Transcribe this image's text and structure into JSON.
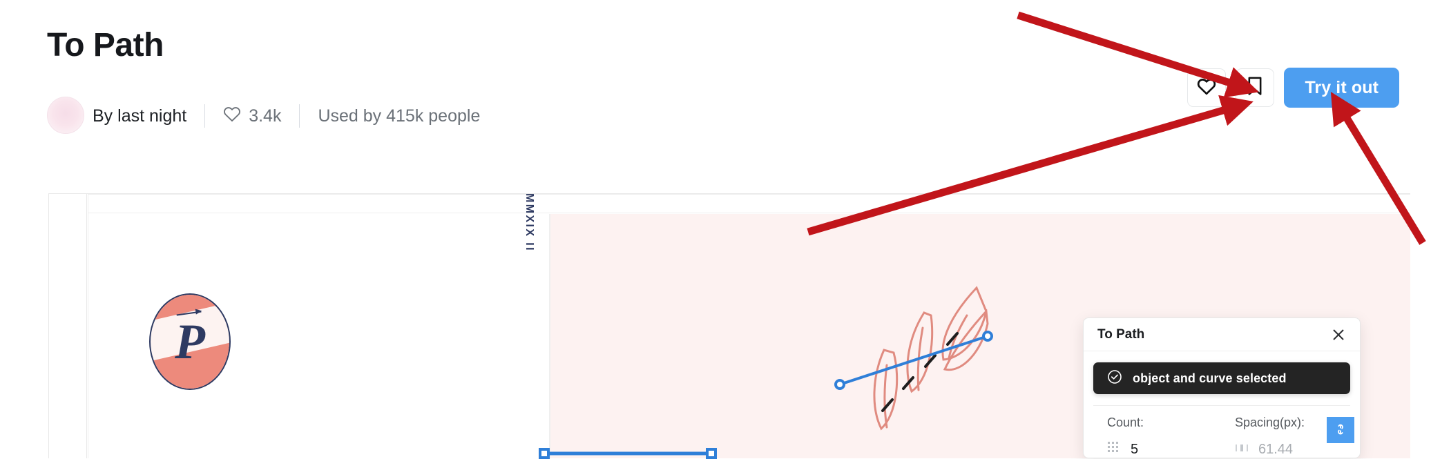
{
  "header": {
    "title": "To Path",
    "author_prefix": "By",
    "author_name": "last night",
    "likes": "3.4k",
    "used_by": "Used by 415k people",
    "heart_icon": "heart-icon",
    "avatar_icon": "avatar"
  },
  "actions": {
    "favorite_icon": "heart-icon",
    "bookmark_icon": "bookmark-icon",
    "try_label": "Try it out",
    "accent_color": "#4d9ef0"
  },
  "canvas": {
    "vertical_mark": "MMXIX II",
    "logo_letter": "P",
    "artboard_bg": "#fdf2f1",
    "brand_navy": "#2e3a62",
    "brand_coral": "#ed8a7c",
    "path_color": "#2f7fd8"
  },
  "plugin_panel": {
    "title": "To Path",
    "close_icon": "close-icon",
    "toast": {
      "icon": "check-circle-icon",
      "message": "object and curve selected"
    },
    "count": {
      "label": "Count:",
      "icon": "grid-dots-icon",
      "value": "5"
    },
    "spacing": {
      "label": "Spacing(px):",
      "icon": "spacing-icon",
      "value": "61.44"
    },
    "link_button": {
      "icon": "link-icon"
    }
  },
  "annotations": {
    "arrow_color": "#c1151a",
    "arrows": [
      {
        "name": "arrow-to-try-button-top"
      },
      {
        "name": "arrow-to-try-button-left"
      },
      {
        "name": "arrow-to-try-button-bottom"
      }
    ]
  }
}
